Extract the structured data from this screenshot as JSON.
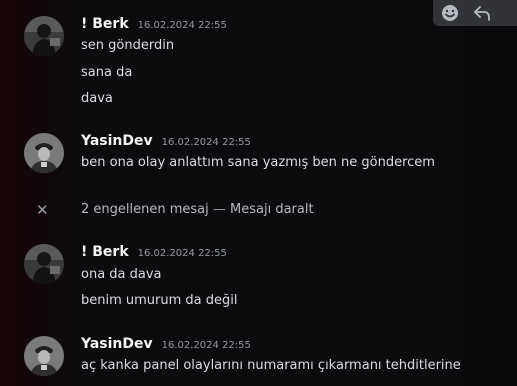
{
  "messages": [
    {
      "username": "! Berk",
      "timestamp": "16.02.2024 22:55",
      "avatar_icon": "avatar-dark-figure",
      "lines": [
        "sen gönderdin",
        "sana da",
        "dava"
      ]
    },
    {
      "username": "YasinDev",
      "timestamp": "16.02.2024 22:55",
      "avatar_icon": "avatar-soldier-portrait",
      "lines": [
        "ben ona olay anlattım sana yazmış ben ne göndercem"
      ]
    },
    {
      "username": "! Berk",
      "timestamp": "16.02.2024 22:55",
      "avatar_icon": "avatar-dark-figure",
      "lines": [
        "ona da dava",
        "benim umurum da değil"
      ]
    },
    {
      "username": "YasinDev",
      "timestamp": "16.02.2024 22:55",
      "avatar_icon": "avatar-soldier-portrait",
      "lines": [
        "aç kanka panel olaylarını numaramı çıkarmanı tehditlerine"
      ]
    }
  ],
  "blocked": {
    "icon": "close-icon",
    "text": "2 engellenen mesaj",
    "separator": "—",
    "action": "Mesajı daralt"
  },
  "toolbar": {
    "icons": [
      "emoji-reaction-icon",
      "reply-icon"
    ]
  },
  "colors": {
    "background": "#0b0b0e",
    "username": "#f2f3f5",
    "message_text": "#dbdee1",
    "muted": "#949ba4",
    "toolbar_bg": "#313338"
  }
}
